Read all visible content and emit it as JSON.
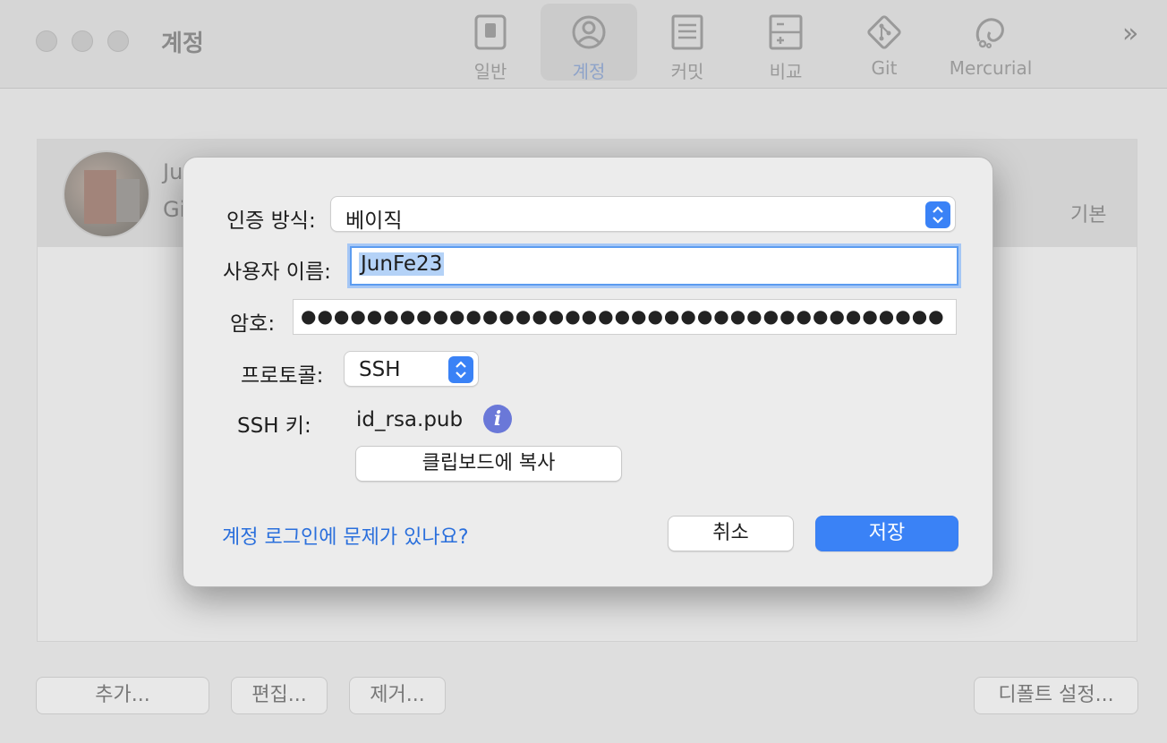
{
  "window": {
    "title": "계정",
    "toolbar": [
      {
        "label": "일반",
        "icon": "general-icon"
      },
      {
        "label": "계정",
        "icon": "account-icon",
        "active": true
      },
      {
        "label": "커밋",
        "icon": "commit-icon"
      },
      {
        "label": "비교",
        "icon": "diff-icon"
      },
      {
        "label": "Git",
        "icon": "git-icon"
      },
      {
        "label": "Mercurial",
        "icon": "mercurial-icon"
      }
    ],
    "overflow": "»"
  },
  "account": {
    "name_partial": "Ju",
    "host_partial": "Gi",
    "default_partial": "기본"
  },
  "bottom_buttons": {
    "add": "추가...",
    "edit": "편집...",
    "remove": "제거...",
    "set_default": "디폴트 설정..."
  },
  "dialog": {
    "auth_label": "인증 방식:",
    "auth_value": "베이직",
    "username_label": "사용자 이름:",
    "username_value": "JunFe23",
    "password_label": "암호:",
    "password_dots": "●●●●●●●●●●●●●●●●●●●●●●●●●●●●●●●●●●●●●●●",
    "protocol_label": "프로토콜:",
    "protocol_value": "SSH",
    "ssh_key_label": "SSH 키:",
    "ssh_key_value": "id_rsa.pub",
    "copy_button": "클립보드에 복사",
    "help_link": "계정 로그인에 문제가 있나요?",
    "cancel_button": "취소",
    "save_button": "저장"
  },
  "colors": {
    "accent": "#3a82f6",
    "link": "#2a6fdc",
    "selection": "#b4d2f7"
  }
}
